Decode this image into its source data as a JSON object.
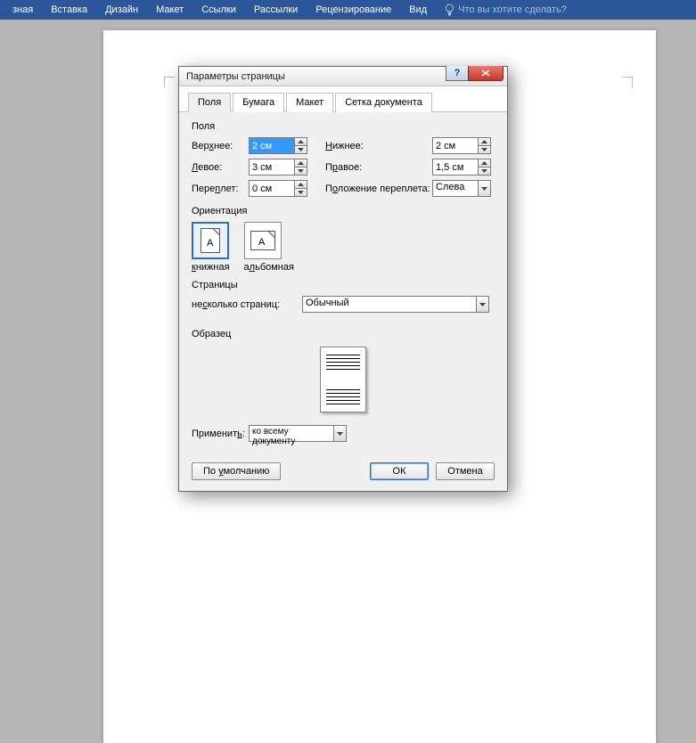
{
  "ribbon": {
    "tabs": [
      "зная",
      "Вставка",
      "Дизайн",
      "Макет",
      "Ссылки",
      "Рассылки",
      "Рецензирование",
      "Вид"
    ],
    "tell_me": "Что вы хотите сделать?"
  },
  "dialog": {
    "title": "Параметры страницы",
    "tabs": {
      "margins": "Поля",
      "paper": "Бумага",
      "layout": "Макет",
      "grid": "Сетка документа"
    },
    "groups": {
      "margins": "Поля",
      "orientation": "Ориентация",
      "pages": "Страницы",
      "sample": "Образец"
    },
    "labels": {
      "top": "Верхнее:",
      "bottom": "Нижнее:",
      "left": "Левое:",
      "right": "Правое:",
      "gutter": "Переплет:",
      "gutter_pos": "Положение переплета:",
      "portrait": "книжная",
      "landscape": "альбомная",
      "multi_pages": "несколько страниц:",
      "apply_to": "Применить:"
    },
    "values": {
      "top": "2 см",
      "bottom": "2 см",
      "left": "3 см",
      "right": "1,5 см",
      "gutter": "0 см",
      "gutter_pos": "Слева",
      "multi_pages": "Обычный",
      "apply_to": "ко всему документу"
    },
    "buttons": {
      "default": "По умолчанию",
      "ok": "ОК",
      "cancel": "Отмена"
    }
  }
}
